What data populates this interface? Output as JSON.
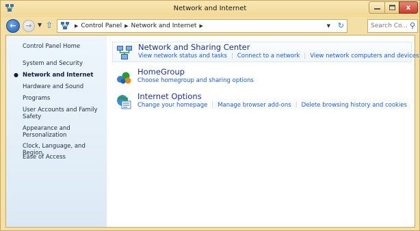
{
  "window": {
    "title": "Network and Internet",
    "close_glyph": "x"
  },
  "navigation": {
    "breadcrumbs": [
      "Control Panel",
      "Network and Internet"
    ],
    "search_placeholder": "Search Co..."
  },
  "sidebar": {
    "items": [
      {
        "label": "Control Panel Home"
      },
      {
        "label": "System and Security"
      },
      {
        "label": "Network and Internet",
        "active": true
      },
      {
        "label": "Hardware and Sound"
      },
      {
        "label": "Programs"
      },
      {
        "label": "User Accounts and Family Safety"
      },
      {
        "label": "Appearance and Personalization"
      },
      {
        "label": "Clock, Language, and Region"
      },
      {
        "label": "Ease of Access"
      }
    ]
  },
  "categories": [
    {
      "title": "Network and Sharing Center",
      "icon": "network-sharing-icon",
      "links": [
        "View network status and tasks",
        "Connect to a network",
        "View network computers and devices"
      ]
    },
    {
      "title": "HomeGroup",
      "icon": "homegroup-icon",
      "links": [
        "Choose homegroup and sharing options"
      ]
    },
    {
      "title": "Internet Options",
      "icon": "internet-options-icon",
      "links": [
        "Change your homepage",
        "Manage browser add-ons",
        "Delete browsing history and cookies"
      ]
    }
  ],
  "colors": {
    "frame": "#f4dfa6",
    "sidebar": "#e4eff9",
    "link": "#1a5ad6",
    "category_title": "#1e3287"
  }
}
